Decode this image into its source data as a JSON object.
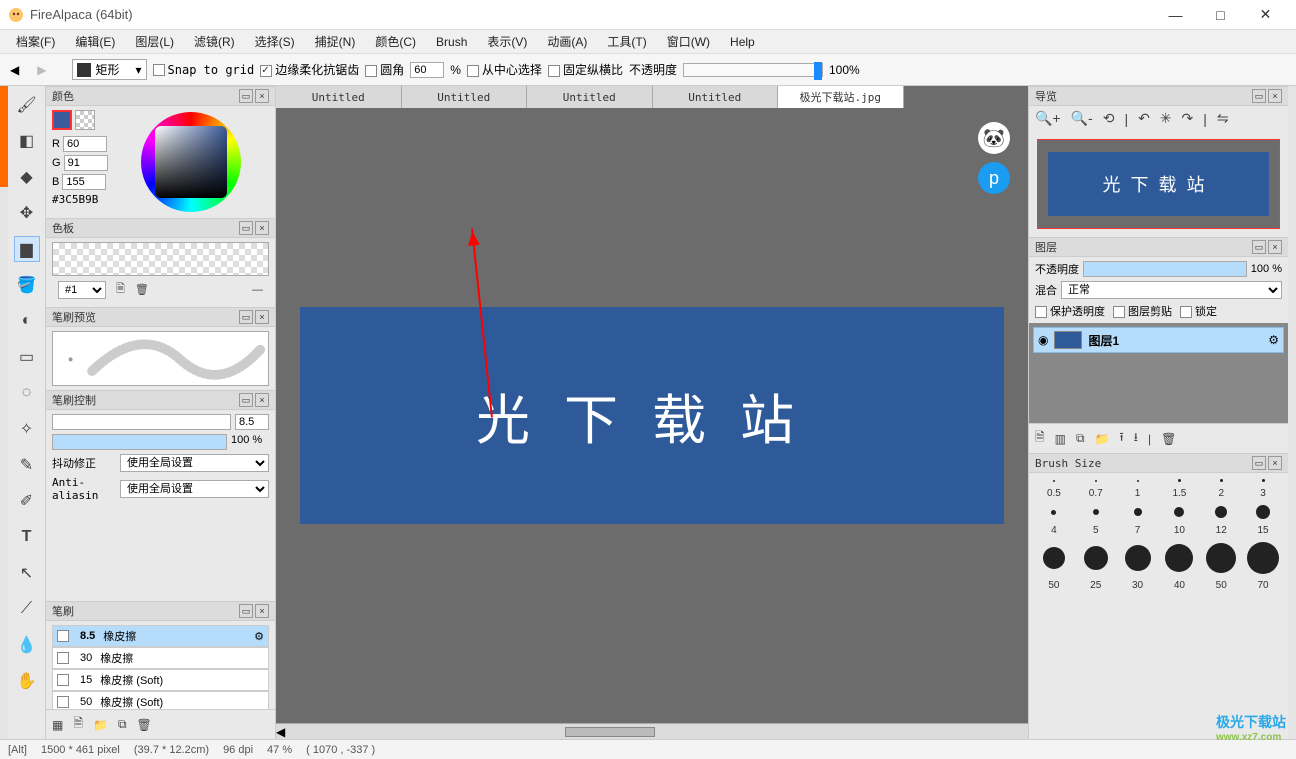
{
  "app": {
    "title": "FireAlpaca (64bit)"
  },
  "menu": [
    "档案(F)",
    "编辑(E)",
    "图层(L)",
    "滤镜(R)",
    "选择(S)",
    "捕捉(N)",
    "颜色(C)",
    "Brush",
    "表示(V)",
    "动画(A)",
    "工具(T)",
    "窗口(W)",
    "Help"
  ],
  "toolbar": {
    "shape": "矩形",
    "snap": "Snap to grid",
    "antialias": "边缘柔化抗锯齿",
    "round": "圆角",
    "round_val": "60",
    "round_unit": "%",
    "from_center": "从中心选择",
    "fix_ratio": "固定纵横比",
    "opacity_label": "不透明度",
    "opacity_val": "100%"
  },
  "panels": {
    "color": {
      "title": "颜色",
      "r": "60",
      "g": "91",
      "b": "155",
      "hex": "#3C5B9B",
      "r_label": "R",
      "g_label": "G",
      "b_label": "B"
    },
    "swatch": {
      "title": "色板",
      "preset": "#1"
    },
    "brushprev": {
      "title": "笔刷预览"
    },
    "brushctrl": {
      "title": "笔刷控制",
      "size": "8.5",
      "opacity": "100 %",
      "jitter_label": "抖动修正",
      "jitter_val": "使用全局设置",
      "aa_label": "Anti-aliasin",
      "aa_val": "使用全局设置"
    },
    "brush": {
      "title": "笔刷",
      "items": [
        {
          "size": "8.5",
          "name": "橡皮擦",
          "sel": true
        },
        {
          "size": "30",
          "name": "橡皮擦"
        },
        {
          "size": "15",
          "name": "橡皮擦 (Soft)"
        },
        {
          "size": "50",
          "name": "橡皮擦 (Soft)"
        }
      ]
    }
  },
  "tabs": [
    "Untitled",
    "Untitled",
    "Untitled",
    "Untitled",
    "极光下载站.jpg"
  ],
  "canvas_text": "光下载站",
  "right": {
    "nav": {
      "title": "导览",
      "thumb_text": "光下载站"
    },
    "layer": {
      "title": "图层",
      "opacity_label": "不透明度",
      "opacity_val": "100 %",
      "blend_label": "混合",
      "blend_val": "正常",
      "protect": "保护透明度",
      "clip": "图层剪贴",
      "lock": "锁定",
      "layer_name": "图层1"
    },
    "brushsize": {
      "title": "Brush Size",
      "labels": [
        "0.5",
        "0.7",
        "1",
        "1.5",
        "2",
        "3",
        "4",
        "5",
        "7",
        "10",
        "12",
        "15",
        "50",
        "25",
        "30",
        "40",
        "50",
        "70"
      ]
    }
  },
  "status": {
    "key": "[Alt]",
    "dims": "1500 * 461 pixel",
    "cm": "(39.7 * 12.2cm)",
    "dpi": "96 dpi",
    "zoom": "47 %",
    "coord": "( 1070 , -337 )"
  },
  "watermark": {
    "t1": "极光下载站",
    "t2": "www.xz7.com"
  }
}
